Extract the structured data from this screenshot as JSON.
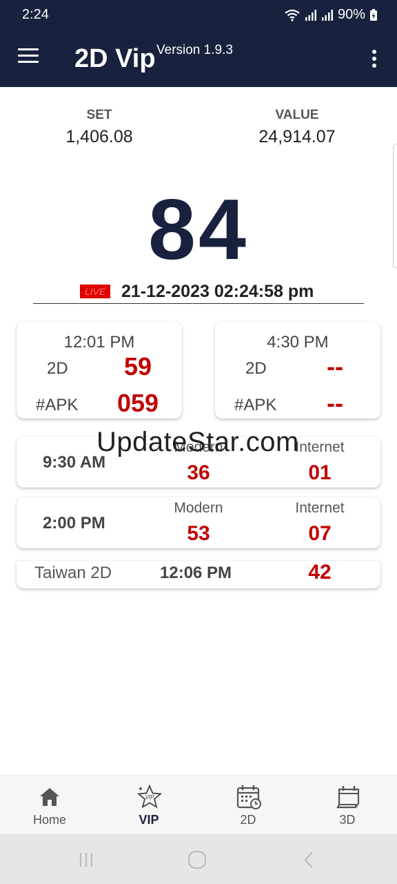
{
  "status_bar": {
    "time": "2:24",
    "battery": "90%"
  },
  "app_bar": {
    "title": "2D Vip",
    "version": "Version 1.9.3",
    "menu_icon": "hamburger-menu-icon",
    "more_icon": "more-vertical-icon"
  },
  "market": {
    "set_label": "SET",
    "set_value": "1,406.08",
    "value_label": "VALUE",
    "value_value": "24,914.07"
  },
  "live_number": "84",
  "live": {
    "badge": "LIVE",
    "datetime": "21-12-2023 02:24:58 pm"
  },
  "sessions": [
    {
      "time": "12:01 PM",
      "twod_label": "2D",
      "twod_value": "59",
      "apk_label": "#APK",
      "apk_value": "059"
    },
    {
      "time": "4:30 PM",
      "twod_label": "2D",
      "twod_value": "--",
      "apk_label": "#APK",
      "apk_value": "--"
    }
  ],
  "modern_internet": [
    {
      "time": "9:30 AM",
      "modern_label": "Modern",
      "modern_value": "36",
      "internet_label": "Internet",
      "internet_value": "01"
    },
    {
      "time": "2:00 PM",
      "modern_label": "Modern",
      "modern_value": "53",
      "internet_label": "Internet",
      "internet_value": "07"
    }
  ],
  "taiwan": {
    "label": "Taiwan 2D",
    "time": "12:06 PM",
    "value": "42"
  },
  "watermark": "UpdateStar.com",
  "bottom_nav": [
    {
      "label": "Home",
      "icon": "home-icon",
      "active": false
    },
    {
      "label": "VIP",
      "icon": "vip-star-icon",
      "active": true
    },
    {
      "label": "2D",
      "icon": "calendar-clock-icon",
      "active": false
    },
    {
      "label": "3D",
      "icon": "calendar-3d-icon",
      "active": false
    }
  ],
  "colors": {
    "app_bar": "#18213d",
    "result_red": "#c00000",
    "live_red": "#e00000"
  }
}
